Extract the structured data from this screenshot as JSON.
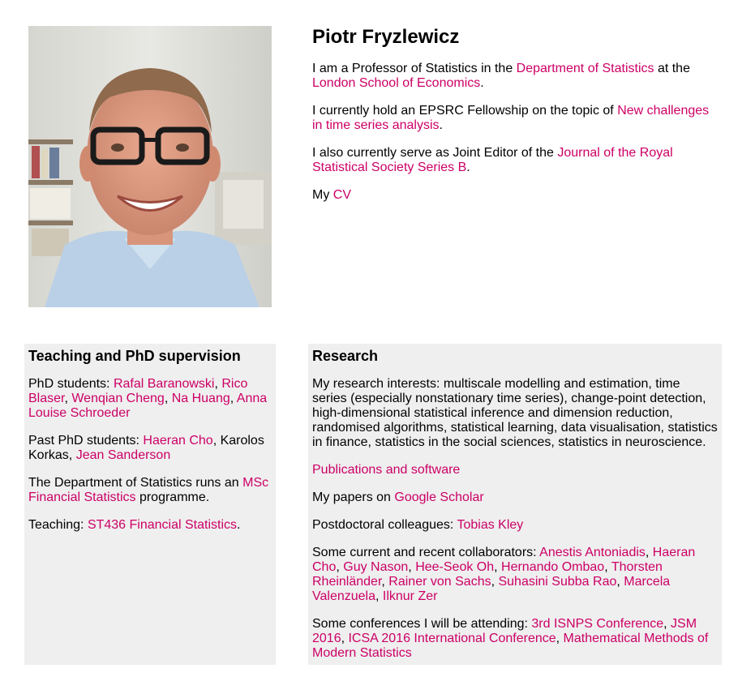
{
  "profile": {
    "name": "Piotr Fryzlewicz",
    "photo_alt": "Portrait photo",
    "p1": {
      "t1": "I am a Professor of Statistics in the ",
      "link1": "Department of Statistics",
      "t2": " at the ",
      "link2": "London School of Economics",
      "t3": "."
    },
    "p2": {
      "t1": "I currently hold an EPSRC Fellowship on the topic of ",
      "link1": "New challenges in time series analysis",
      "t2": "."
    },
    "p3": {
      "t1": "I also currently serve as Joint Editor of the ",
      "link1": "Journal of the Royal Statistical Society Series B",
      "t2": "."
    },
    "p4": {
      "t1": "My ",
      "link1": "CV"
    }
  },
  "teaching": {
    "title": "Teaching and PhD supervision",
    "phd": {
      "label": "PhD students: ",
      "students": [
        "Rafal Baranowski",
        "Rico Blaser",
        "Wenqian Cheng",
        "Na Huang",
        "Anna Louise Schroeder"
      ]
    },
    "past": {
      "label": "Past PhD students: ",
      "s1": "Haeran Cho",
      "mid": ", Karolos Korkas, ",
      "s2": "Jean Sanderson"
    },
    "msc": {
      "t1": "The Department of Statistics runs an ",
      "link": "MSc Financial Statistics",
      "t2": " programme."
    },
    "course": {
      "label": "Teaching: ",
      "link": "ST436 Financial Statistics",
      "t2": "."
    }
  },
  "research": {
    "title": "Research",
    "interests": "My research interests: multiscale modelling and estimation, time series (especially nonstationary time series), change-point detection, high-dimensional statistical inference and dimension reduction, randomised algorithms, statistical learning, data visualisation, statistics in finance, statistics in the social sciences, statistics in neuroscience.",
    "publications_link": "Publications and software",
    "scholar": {
      "t1": "My papers on ",
      "link": "Google Scholar"
    },
    "postdoc": {
      "label": "Postdoctoral colleagues: ",
      "link": "Tobias Kley"
    },
    "collaborators": {
      "label": "Some current and recent collaborators: ",
      "names": [
        "Anestis Antoniadis",
        "Haeran Cho",
        "Guy Nason",
        "Hee-Seok Oh",
        "Hernando Ombao",
        "Thorsten Rheinländer",
        "Rainer von Sachs",
        "Suhasini Subba Rao",
        "Marcela Valenzuela",
        "Ilknur Zer"
      ]
    },
    "conferences": {
      "label": "Some conferences I will be attending: ",
      "names": [
        "3rd ISNPS Conference",
        "JSM 2016",
        "ICSA 2016 International Conference",
        "Mathematical Methods of Modern Statistics"
      ]
    }
  },
  "colors": {
    "link": "#cc0066",
    "box_background": "#efefef"
  }
}
